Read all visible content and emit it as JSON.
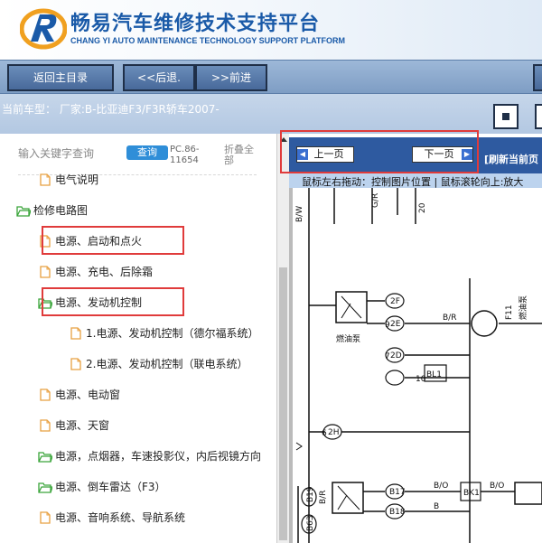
{
  "header": {
    "title_cn": "畅易汽车维修技术支持平台",
    "title_en": "CHANG YI AUTO MAINTENANCE TECHNOLOGY SUPPORT PLATFORM",
    "logo_icon": "r-swoosh-logo-icon"
  },
  "nav": {
    "home": "返回主目录",
    "back": "<<后退.",
    "forward": ">>前进"
  },
  "model": {
    "label": "当前车型：  厂家:B-比亚迪F3/F3R轿车2007-"
  },
  "search": {
    "placeholder": "输入关键字查询",
    "query_button": "查询",
    "code": "PC.86-11654",
    "collapse_all": "折叠全部"
  },
  "tree": [
    {
      "label": "电气说明",
      "icon": "file-icon",
      "indent": 1
    },
    {
      "label": "检修电路图",
      "icon": "folder-open-icon",
      "indent": 0
    },
    {
      "label": "电源、启动和点火",
      "icon": "file-icon",
      "indent": 1,
      "highlighted": true
    },
    {
      "label": "电源、充电、后除霜",
      "icon": "file-icon",
      "indent": 1
    },
    {
      "label": "电源、发动机控制",
      "icon": "folder-open-icon",
      "indent": 1,
      "highlighted": true
    },
    {
      "label": "1.电源、发动机控制（德尔福系统）",
      "icon": "file-icon",
      "indent": 2
    },
    {
      "label": "2.电源、发动机控制（联电系统）",
      "icon": "file-icon",
      "indent": 2
    },
    {
      "label": "电源、电动窗",
      "icon": "file-icon",
      "indent": 1
    },
    {
      "label": "电源、天窗",
      "icon": "file-icon",
      "indent": 1
    },
    {
      "label": "电源，点烟器，车速投影仪，内后视镜方向",
      "icon": "folder-open-icon",
      "indent": 1
    },
    {
      "label": "电源、倒车雷达（F3）",
      "icon": "folder-open-icon",
      "indent": 1
    },
    {
      "label": "电源、音响系统、导航系统",
      "icon": "file-icon",
      "indent": 1
    }
  ],
  "viewer": {
    "prev_page": "上一页",
    "next_page": "下一页",
    "refresh": "[刷新当前页",
    "hint": "鼠标左右拖动：控制图片位置 | 鼠标滚轮向上:放大"
  },
  "diagram": {
    "labels": [
      "B/W",
      "G/R",
      "20",
      "2F",
      "燃油泵",
      "B/R",
      "F11",
      "燃油泵",
      "9",
      "2E",
      "7",
      "2D",
      "10",
      "BL1",
      "6",
      "2H",
      "B/O",
      "B/O",
      "B17",
      "BK1",
      "B18",
      "B19",
      "B/R",
      "B",
      "B63"
    ]
  },
  "colors": {
    "brand_blue": "#1a5aa8",
    "nav_bg": "#7e9dc4",
    "pager_bg": "#2e5aa0",
    "highlight_red": "#e03b3b",
    "folder_green": "#3aa53a",
    "file_orange": "#e8a040"
  }
}
